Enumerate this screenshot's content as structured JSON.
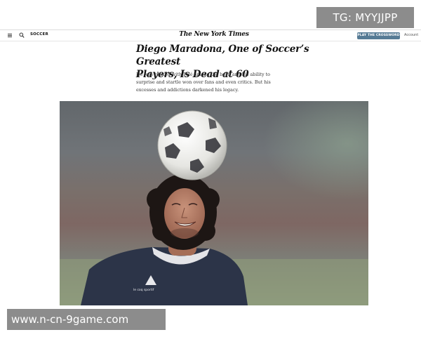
{
  "watermarks": {
    "top": "TG: MYYJJPP",
    "bottom": "www.n-cn-9game.com"
  },
  "header": {
    "menu_icon": "hamburger-menu-icon",
    "search_icon": "search-icon",
    "section": "SOCCER",
    "masthead": "The New York Times",
    "crossword_button": "PLAY THE CROSSWORD",
    "account": "Account"
  },
  "article": {
    "headline_line1": "Diego Maradona, One of Soccer’s Greatest",
    "headline_line2": "Players, Is Dead at 60",
    "summary_line1": "He was ranked with Pelé among the best, and his ability to",
    "summary_line2": "surprise and startle won over fans and even critics. But his",
    "summary_line3": "excesses and addictions darkened his legacy.",
    "photo_brand": "le coq sportif"
  },
  "colors": {
    "crossword_button_bg": "#567b95",
    "watermark_bg": "#8c8c8c",
    "shirt": "#2c3448"
  }
}
